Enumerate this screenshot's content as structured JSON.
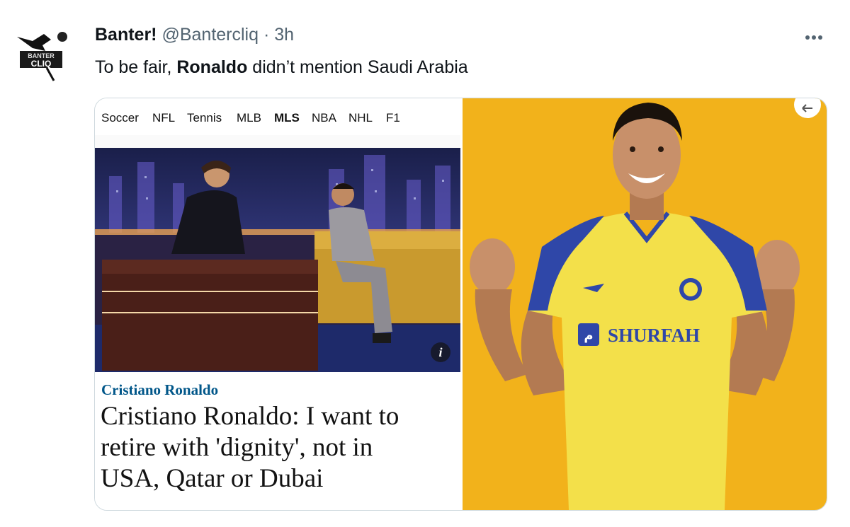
{
  "tweet": {
    "author_name": "Banter!",
    "handle": "@Bantercliq",
    "time_separator": "·",
    "time": "3h",
    "more_icon": "more-horizontal-icon",
    "text_before": "To be fair, ",
    "text_bold": "Ronaldo",
    "text_after": " didn’t mention Saudi Arabia",
    "avatar_lines": [
      "BANTER",
      "CLIQ"
    ]
  },
  "article": {
    "nav": [
      "Soccer",
      "NFL",
      "Tennis",
      "MLB",
      "MLS",
      "NBA",
      "NHL",
      "F1"
    ],
    "active_nav": "MLS",
    "info_label": "i",
    "kicker": "Cristiano Ronaldo",
    "headline_lines": [
      "Cristiano Ronaldo: I want to",
      "retire with 'dignity', not in",
      "USA, Qatar or Dubai"
    ],
    "kicker_color": "#005689"
  },
  "photo": {
    "shirt_sponsor": "SHURFAH",
    "sponsor_logo": "م",
    "background_color": "#f2b21b",
    "shirt_color": "#f3e04a",
    "sleeve_color": "#2f47a8"
  }
}
